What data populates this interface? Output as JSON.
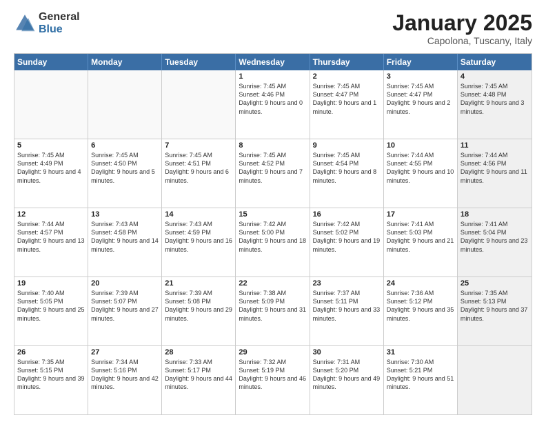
{
  "logo": {
    "general": "General",
    "blue": "Blue"
  },
  "title": "January 2025",
  "location": "Capolona, Tuscany, Italy",
  "days": [
    "Sunday",
    "Monday",
    "Tuesday",
    "Wednesday",
    "Thursday",
    "Friday",
    "Saturday"
  ],
  "rows": [
    [
      {
        "num": "",
        "sunrise": "",
        "sunset": "",
        "daylight": "",
        "empty": true
      },
      {
        "num": "",
        "sunrise": "",
        "sunset": "",
        "daylight": "",
        "empty": true
      },
      {
        "num": "",
        "sunrise": "",
        "sunset": "",
        "daylight": "",
        "empty": true
      },
      {
        "num": "1",
        "sunrise": "Sunrise: 7:45 AM",
        "sunset": "Sunset: 4:46 PM",
        "daylight": "Daylight: 9 hours and 0 minutes."
      },
      {
        "num": "2",
        "sunrise": "Sunrise: 7:45 AM",
        "sunset": "Sunset: 4:47 PM",
        "daylight": "Daylight: 9 hours and 1 minute."
      },
      {
        "num": "3",
        "sunrise": "Sunrise: 7:45 AM",
        "sunset": "Sunset: 4:47 PM",
        "daylight": "Daylight: 9 hours and 2 minutes."
      },
      {
        "num": "4",
        "sunrise": "Sunrise: 7:45 AM",
        "sunset": "Sunset: 4:48 PM",
        "daylight": "Daylight: 9 hours and 3 minutes.",
        "shaded": true
      }
    ],
    [
      {
        "num": "5",
        "sunrise": "Sunrise: 7:45 AM",
        "sunset": "Sunset: 4:49 PM",
        "daylight": "Daylight: 9 hours and 4 minutes."
      },
      {
        "num": "6",
        "sunrise": "Sunrise: 7:45 AM",
        "sunset": "Sunset: 4:50 PM",
        "daylight": "Daylight: 9 hours and 5 minutes."
      },
      {
        "num": "7",
        "sunrise": "Sunrise: 7:45 AM",
        "sunset": "Sunset: 4:51 PM",
        "daylight": "Daylight: 9 hours and 6 minutes."
      },
      {
        "num": "8",
        "sunrise": "Sunrise: 7:45 AM",
        "sunset": "Sunset: 4:52 PM",
        "daylight": "Daylight: 9 hours and 7 minutes."
      },
      {
        "num": "9",
        "sunrise": "Sunrise: 7:45 AM",
        "sunset": "Sunset: 4:54 PM",
        "daylight": "Daylight: 9 hours and 8 minutes."
      },
      {
        "num": "10",
        "sunrise": "Sunrise: 7:44 AM",
        "sunset": "Sunset: 4:55 PM",
        "daylight": "Daylight: 9 hours and 10 minutes."
      },
      {
        "num": "11",
        "sunrise": "Sunrise: 7:44 AM",
        "sunset": "Sunset: 4:56 PM",
        "daylight": "Daylight: 9 hours and 11 minutes.",
        "shaded": true
      }
    ],
    [
      {
        "num": "12",
        "sunrise": "Sunrise: 7:44 AM",
        "sunset": "Sunset: 4:57 PM",
        "daylight": "Daylight: 9 hours and 13 minutes."
      },
      {
        "num": "13",
        "sunrise": "Sunrise: 7:43 AM",
        "sunset": "Sunset: 4:58 PM",
        "daylight": "Daylight: 9 hours and 14 minutes."
      },
      {
        "num": "14",
        "sunrise": "Sunrise: 7:43 AM",
        "sunset": "Sunset: 4:59 PM",
        "daylight": "Daylight: 9 hours and 16 minutes."
      },
      {
        "num": "15",
        "sunrise": "Sunrise: 7:42 AM",
        "sunset": "Sunset: 5:00 PM",
        "daylight": "Daylight: 9 hours and 18 minutes."
      },
      {
        "num": "16",
        "sunrise": "Sunrise: 7:42 AM",
        "sunset": "Sunset: 5:02 PM",
        "daylight": "Daylight: 9 hours and 19 minutes."
      },
      {
        "num": "17",
        "sunrise": "Sunrise: 7:41 AM",
        "sunset": "Sunset: 5:03 PM",
        "daylight": "Daylight: 9 hours and 21 minutes."
      },
      {
        "num": "18",
        "sunrise": "Sunrise: 7:41 AM",
        "sunset": "Sunset: 5:04 PM",
        "daylight": "Daylight: 9 hours and 23 minutes.",
        "shaded": true
      }
    ],
    [
      {
        "num": "19",
        "sunrise": "Sunrise: 7:40 AM",
        "sunset": "Sunset: 5:05 PM",
        "daylight": "Daylight: 9 hours and 25 minutes."
      },
      {
        "num": "20",
        "sunrise": "Sunrise: 7:39 AM",
        "sunset": "Sunset: 5:07 PM",
        "daylight": "Daylight: 9 hours and 27 minutes."
      },
      {
        "num": "21",
        "sunrise": "Sunrise: 7:39 AM",
        "sunset": "Sunset: 5:08 PM",
        "daylight": "Daylight: 9 hours and 29 minutes."
      },
      {
        "num": "22",
        "sunrise": "Sunrise: 7:38 AM",
        "sunset": "Sunset: 5:09 PM",
        "daylight": "Daylight: 9 hours and 31 minutes."
      },
      {
        "num": "23",
        "sunrise": "Sunrise: 7:37 AM",
        "sunset": "Sunset: 5:11 PM",
        "daylight": "Daylight: 9 hours and 33 minutes."
      },
      {
        "num": "24",
        "sunrise": "Sunrise: 7:36 AM",
        "sunset": "Sunset: 5:12 PM",
        "daylight": "Daylight: 9 hours and 35 minutes."
      },
      {
        "num": "25",
        "sunrise": "Sunrise: 7:35 AM",
        "sunset": "Sunset: 5:13 PM",
        "daylight": "Daylight: 9 hours and 37 minutes.",
        "shaded": true
      }
    ],
    [
      {
        "num": "26",
        "sunrise": "Sunrise: 7:35 AM",
        "sunset": "Sunset: 5:15 PM",
        "daylight": "Daylight: 9 hours and 39 minutes."
      },
      {
        "num": "27",
        "sunrise": "Sunrise: 7:34 AM",
        "sunset": "Sunset: 5:16 PM",
        "daylight": "Daylight: 9 hours and 42 minutes."
      },
      {
        "num": "28",
        "sunrise": "Sunrise: 7:33 AM",
        "sunset": "Sunset: 5:17 PM",
        "daylight": "Daylight: 9 hours and 44 minutes."
      },
      {
        "num": "29",
        "sunrise": "Sunrise: 7:32 AM",
        "sunset": "Sunset: 5:19 PM",
        "daylight": "Daylight: 9 hours and 46 minutes."
      },
      {
        "num": "30",
        "sunrise": "Sunrise: 7:31 AM",
        "sunset": "Sunset: 5:20 PM",
        "daylight": "Daylight: 9 hours and 49 minutes."
      },
      {
        "num": "31",
        "sunrise": "Sunrise: 7:30 AM",
        "sunset": "Sunset: 5:21 PM",
        "daylight": "Daylight: 9 hours and 51 minutes."
      },
      {
        "num": "",
        "sunrise": "",
        "sunset": "",
        "daylight": "",
        "empty": true,
        "shaded": true
      }
    ]
  ]
}
